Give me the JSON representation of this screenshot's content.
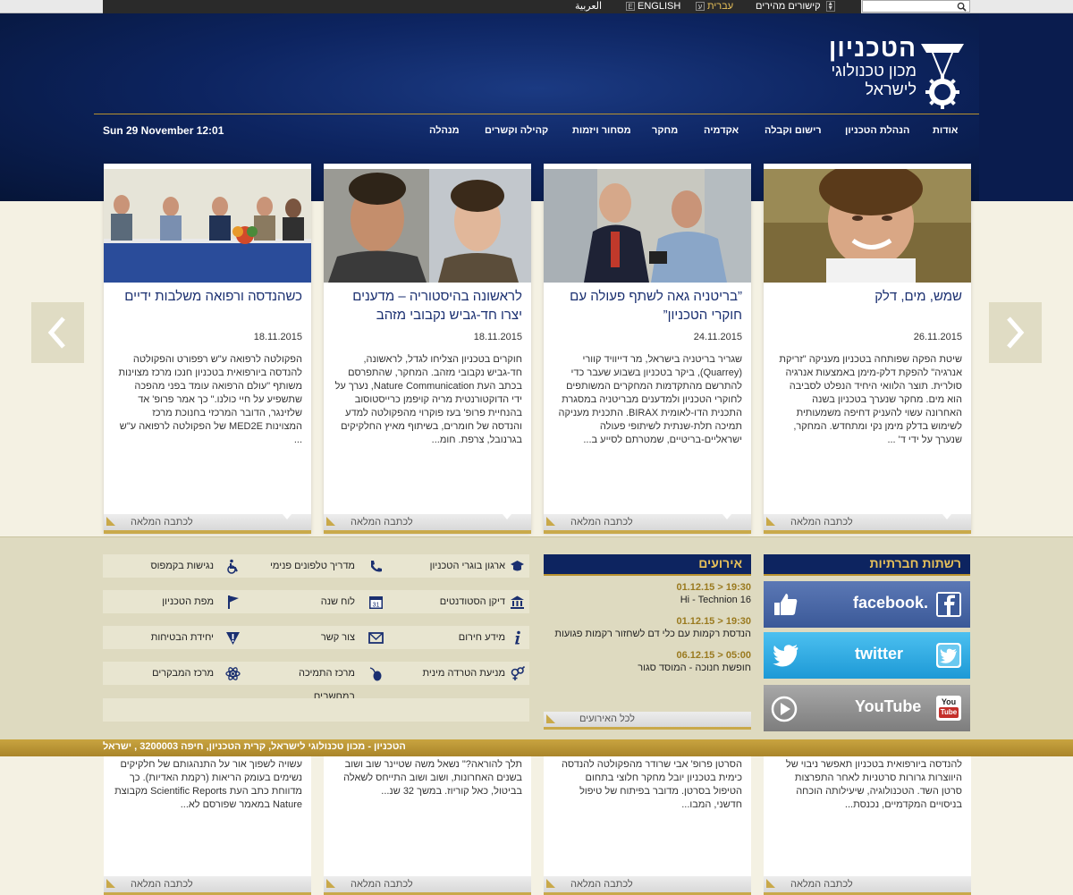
{
  "topbar": {
    "arabic": "العربية",
    "english": "ENGLISH",
    "english_badge": "E",
    "hebrew": "עברית",
    "hebrew_badge": "ע",
    "quick_links": "קישורים מהירים",
    "search_placeholder": ""
  },
  "logo": {
    "title": "הטכניון",
    "sub1": "מכון טכנולוגי",
    "sub2": "לישראל"
  },
  "nav": {
    "date": "Sun 29 November 12:01",
    "items": [
      "אודות",
      "הנהלת הטכניון",
      "רישום וקבלה",
      "אקדמיה",
      "מחקר",
      "מסחור ויזמות",
      "קהילה וקשרים",
      "מנהלה"
    ]
  },
  "cards": [
    {
      "title": "שמש, מים, דלק",
      "date": "26.11.2015",
      "body": "שיטת הפקה שפותחה בטכניון מעניקה \"זריקת אנרגיה\" להפקת דלק-מימן באמצעות אנרגיה סולרית. תוצר הלוואי היחיד הנפלט לסביבה הוא מים. מחקר שנערך בטכניון בשנה האחרונה עשוי להעניק דחיפה משמעותית לשימוש בדלק מימן נקי ומתחדש. המחקר, שנערך על ידי ד' ...",
      "more": "לכתבה המלאה",
      "lower": "להנדסה ביורפואית בטכניון תאפשר ניבוי של היווצרות גרורות סרטניות לאחר התפרצות סרטן השד. הטכנולוגיה, שיעילותה הוכחה בניסויים המקדמיים, נכנסת..."
    },
    {
      "title": "”בריטניה גאה לשתף פעולה עם חוקרי הטכניון”",
      "date": "24.11.2015",
      "body": "שגריר בריטניה בישראל, מר דייוויד קוורי (Quarrey), ביקר בטכניון בשבוע שעבר כדי להתרשם מהתקדמות המחקרים המשותפים לחוקרי הטכניון ולמדענים מבריטניה במסגרת התכנית הדו-לאומית BIRAX. התכנית מעניקה תמיכה תלת-שנתית לשיתופי פעולה ישראליים-בריטיים, שמטרתם לסייע ב...",
      "more": "לכתבה המלאה",
      "lower": "הסרטן פרופ' אבי שרודר מהפקולטה להנדסה כימית בטכניון יובל מחקר חלוצי בתחום הטיפול בסרטן. מדובר בפיתוח של טיפול חדשני, המבו..."
    },
    {
      "title": "לראשונה בהיסטוריה – מדענים יצרו חד-גביש נקבובי מזהב",
      "date": "18.11.2015",
      "body": "חוקרים בטכניון הצליחו לגדל, לראשונה, חד-גביש נקבובי מזהב. המחקר, שהתפרסם בכתב העת Nature Communication, נערך על ידי הדוקטורנטית מריה קויפמן כרייסטוסוב בהנחיית פרופ' בעז פוקרוי מהפקולטה למדע והנדסה של חומרים, בשיתוף מאיץ החלקיקים בגרנובל, צרפת. חומ...",
      "more": "לכתבה המלאה",
      "lower": "תלך להוראה?\" נשאל משה שטיינר שוב ושוב בשנים האחרונות, ושוב ושוב התייחס לשאלה בביטול, כאל קוריוז. במשך 32 שנ..."
    },
    {
      "title": "כשהנדסה ורפואה משלבות ידיים",
      "date": "18.11.2015",
      "body": "הפקולטה לרפואה ע\"ש רפפורט והפקולטה להנדסה ביורפואית בטכניון חנכו מרכז מצוינות משותף \"עולם הרפואה עומד בפני מהפכה שתשפיע על חיי כולנו.\" כך אמר פרופ' אד שלזינגר, הדובר המרכזי בחנוכת מרכז המצוינות MED2E של הפקולטה לרפואה ע\"ש ...",
      "more": "לכתבה המלאה",
      "lower": "עשויה לשפוך אור על התנהגותם של חלקיקים נשימים בעומק הריאות (רקמת האדיות). כך מדווחת כתב העת Scientific Reports מקבוצת Nature במאמר שפורסם לא..."
    }
  ],
  "links": [
    [
      "ארגון בוגרי הטכניון",
      "מדריך טלפונים פנימי",
      "נגישות בקמפוס"
    ],
    [
      "דיקן הסטודנטים",
      "לוח שנה",
      "מפת הטכניון"
    ],
    [
      "מידע חירום",
      "צור קשר",
      "יחידת הבטיחות"
    ],
    [
      "מניעת הטרדה מינית",
      "מרכז התמיכה במחשבים",
      "מרכז המבקרים"
    ]
  ],
  "events": {
    "title": "אירועים",
    "items": [
      {
        "time": "19:30 < 01.12.15",
        "text": "Hi - Technion 16"
      },
      {
        "time": "19:30 < 01.12.15",
        "text": "הנדסת רקמות עם כלי דם לשחזור רקמות פגועות"
      },
      {
        "time": "05:00 < 06.12.15",
        "text": "חופשת חנוכה - המוסד סגור"
      }
    ],
    "all": "לכל האירועים"
  },
  "social": {
    "title": "רשתות חברתיות",
    "facebook": "facebook.",
    "twitter": "twitter",
    "youtube": "YouTube",
    "youtube_badge_top": "You",
    "youtube_badge_bottom": "Tube"
  },
  "footer": {
    "address": "הטכניון - מכון טכנולוגי לישראל, קרית הטכניון, חיפה 3200003 , ישראל"
  },
  "colors": {
    "header_blue": "#0d2460",
    "gold": "#c9a94a",
    "band": "#dedac0",
    "facebook": "#3b5998",
    "twitter": "#2ba6e1",
    "youtube": "#8a8a8a"
  }
}
